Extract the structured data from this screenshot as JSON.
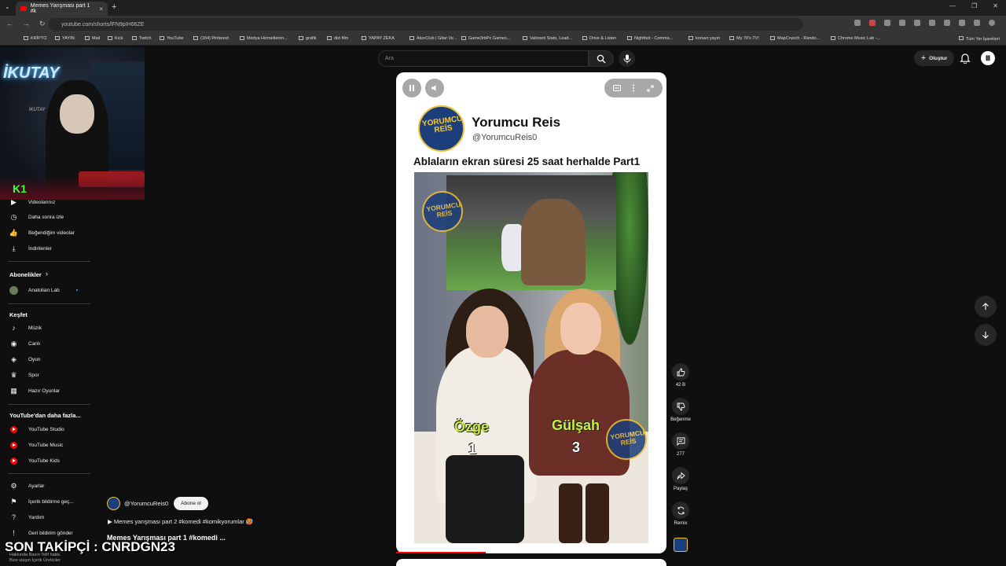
{
  "browser": {
    "tab_title": "Memes Yarışması part 1 #k",
    "url": "youtube.com/shorts/lFN9pIH66ZE",
    "bookmarks": [
      "KRİPTO",
      "YAYIN",
      "Mail",
      "Kick",
      "Twitch",
      "YouTube",
      "(164) Pinterest",
      "Medya Hizmetlerim...",
      "grafik",
      "dizi film",
      "YAPAY ZEKA",
      "AkorClub | Gitar Ve...",
      "Game3rbPc Games...",
      "Valorant Stats, Lead...",
      "Drive & Listen",
      "Nightbot - Comma...",
      "korsan yayın",
      "My 70's TV!",
      "MapCrunch - Rando...",
      "Chrome Music Lab -..."
    ],
    "bookmarks_right": "Tüm Yer İşaretleri"
  },
  "stream": {
    "neon_sign": "İKUTAY",
    "webcam_label": "İKUTAY",
    "k1": "K1",
    "follower": "SON TAKİPÇİ : CNRDGN23"
  },
  "header": {
    "search_placeholder": "Ara",
    "create_label": "Oluştur"
  },
  "sidebar": {
    "you_items": [
      {
        "label": "Videolarınız",
        "icon": "video-icon"
      },
      {
        "label": "Daha sonra izle",
        "icon": "clock-icon"
      },
      {
        "label": "Beğendiğim videolar",
        "icon": "thumb-up-icon"
      },
      {
        "label": "İndirilenler",
        "icon": "download-icon"
      }
    ],
    "subs_title": "Abonelikler",
    "subs": [
      {
        "label": "Anatolian Lab"
      }
    ],
    "explore_title": "Keşfet",
    "explore_items": [
      {
        "label": "Müzik",
        "icon": "music-icon"
      },
      {
        "label": "Canlı",
        "icon": "live-icon"
      },
      {
        "label": "Oyun",
        "icon": "gamepad-icon"
      },
      {
        "label": "Spor",
        "icon": "trophy-icon"
      },
      {
        "label": "Hazır Oyunlar",
        "icon": "grid-icon"
      }
    ],
    "more_title": "YouTube'dan daha fazla...",
    "more_items": [
      {
        "label": "YouTube Studio"
      },
      {
        "label": "YouTube Music"
      },
      {
        "label": "YouTube Kids"
      }
    ],
    "settings_items": [
      {
        "label": "Ayarlar",
        "icon": "gear-icon"
      },
      {
        "label": "İçerik bildirme geç...",
        "icon": "flag-icon"
      },
      {
        "label": "Yardım",
        "icon": "help-icon"
      },
      {
        "label": "Geri bildirim gönder",
        "icon": "feedback-icon"
      }
    ],
    "footer_line1": "Hakkında   Basın   Telif hakkı",
    "footer_line2": "Bize ulaşın   İçerik Üreticiler"
  },
  "short": {
    "channel_name": "Yorumcu Reis",
    "channel_handle": "@YorumcuReis0",
    "logo_text": "YORUMCU REİS",
    "title": "Ablaların ekran süresi 25 saat herhalde Part1",
    "left_name": "Özge",
    "left_number": "1",
    "right_name": "Gülşah",
    "right_number": "3",
    "progress": 0.33
  },
  "actions": {
    "likes": "42 B",
    "dislike": "Beğenme",
    "comments": "277",
    "share": "Paylaş",
    "remix": "Remix"
  },
  "meta": {
    "handle": "@YorumcuReis0",
    "subscribe": "Abone ol",
    "music": "▶ Memes yarışması part 2 #komedi #komikyorumlar 🥵",
    "title": "Memes Yarışması part 1 #komedi ..."
  }
}
